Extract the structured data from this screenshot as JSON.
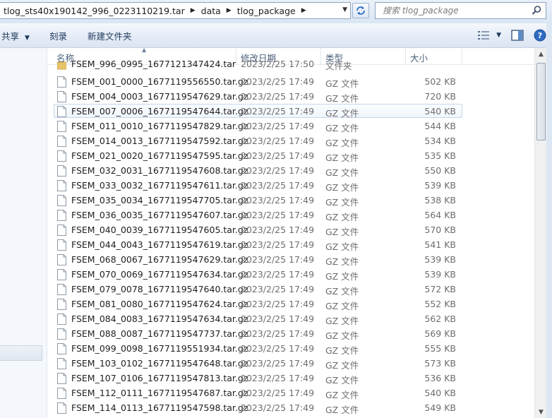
{
  "address": {
    "crumbs": [
      "tlog_sts40x190142_996_0223110219.tar",
      "data",
      "tlog_package"
    ],
    "search_placeholder": "搜索 tlog_package"
  },
  "toolbar": {
    "share": "共享",
    "burn": "刻录",
    "new_folder": "新建文件夹"
  },
  "columns": {
    "name": "名称",
    "date": "修改日期",
    "type": "类型",
    "size": "大小"
  },
  "partial_row": {
    "name": "FSEM_996_0995_1677121347424.tar",
    "date": "2023/2/25 17:50",
    "type": "文件夹"
  },
  "files": [
    {
      "name": "FSEM_001_0000_1677119556550.tar.gz",
      "date": "2023/2/25 17:49",
      "type": "GZ 文件",
      "size": "502 KB"
    },
    {
      "name": "FSEM_004_0003_1677119547629.tar.gz",
      "date": "2023/2/25 17:49",
      "type": "GZ 文件",
      "size": "720 KB"
    },
    {
      "name": "FSEM_007_0006_1677119547644.tar.gz",
      "date": "2023/2/25 17:49",
      "type": "GZ 文件",
      "size": "540 KB"
    },
    {
      "name": "FSEM_011_0010_1677119547829.tar.gz",
      "date": "2023/2/25 17:49",
      "type": "GZ 文件",
      "size": "544 KB"
    },
    {
      "name": "FSEM_014_0013_1677119547592.tar.gz",
      "date": "2023/2/25 17:49",
      "type": "GZ 文件",
      "size": "534 KB"
    },
    {
      "name": "FSEM_021_0020_1677119547595.tar.gz",
      "date": "2023/2/25 17:49",
      "type": "GZ 文件",
      "size": "535 KB"
    },
    {
      "name": "FSEM_032_0031_1677119547608.tar.gz",
      "date": "2023/2/25 17:49",
      "type": "GZ 文件",
      "size": "550 KB"
    },
    {
      "name": "FSEM_033_0032_1677119547611.tar.gz",
      "date": "2023/2/25 17:49",
      "type": "GZ 文件",
      "size": "539 KB"
    },
    {
      "name": "FSEM_035_0034_1677119547705.tar.gz",
      "date": "2023/2/25 17:49",
      "type": "GZ 文件",
      "size": "538 KB"
    },
    {
      "name": "FSEM_036_0035_1677119547607.tar.gz",
      "date": "2023/2/25 17:49",
      "type": "GZ 文件",
      "size": "564 KB"
    },
    {
      "name": "FSEM_040_0039_1677119547605.tar.gz",
      "date": "2023/2/25 17:49",
      "type": "GZ 文件",
      "size": "570 KB"
    },
    {
      "name": "FSEM_044_0043_1677119547619.tar.gz",
      "date": "2023/2/25 17:49",
      "type": "GZ 文件",
      "size": "541 KB"
    },
    {
      "name": "FSEM_068_0067_1677119547629.tar.gz",
      "date": "2023/2/25 17:49",
      "type": "GZ 文件",
      "size": "539 KB"
    },
    {
      "name": "FSEM_070_0069_1677119547634.tar.gz",
      "date": "2023/2/25 17:49",
      "type": "GZ 文件",
      "size": "539 KB"
    },
    {
      "name": "FSEM_079_0078_1677119547640.tar.gz",
      "date": "2023/2/25 17:49",
      "type": "GZ 文件",
      "size": "572 KB"
    },
    {
      "name": "FSEM_081_0080_1677119547624.tar.gz",
      "date": "2023/2/25 17:49",
      "type": "GZ 文件",
      "size": "552 KB"
    },
    {
      "name": "FSEM_084_0083_1677119547634.tar.gz",
      "date": "2023/2/25 17:49",
      "type": "GZ 文件",
      "size": "562 KB"
    },
    {
      "name": "FSEM_088_0087_1677119547737.tar.gz",
      "date": "2023/2/25 17:49",
      "type": "GZ 文件",
      "size": "569 KB"
    },
    {
      "name": "FSEM_099_0098_1677119551934.tar.gz",
      "date": "2023/2/25 17:49",
      "type": "GZ 文件",
      "size": "555 KB"
    },
    {
      "name": "FSEM_103_0102_1677119547648.tar.gz",
      "date": "2023/2/25 17:49",
      "type": "GZ 文件",
      "size": "573 KB"
    },
    {
      "name": "FSEM_107_0106_1677119547813.tar.gz",
      "date": "2023/2/25 17:49",
      "type": "GZ 文件",
      "size": "536 KB"
    },
    {
      "name": "FSEM_112_0111_1677119547687.tar.gz",
      "date": "2023/2/25 17:49",
      "type": "GZ 文件",
      "size": "540 KB"
    },
    {
      "name": "FSEM_114_0113_1677119547598.tar.gz",
      "date": "2023/2/25 17:49",
      "type": "GZ 文件",
      "size": "549 KB"
    }
  ],
  "highlighted_file": "FSEM_007_0006_1677119547644.tar.gz"
}
